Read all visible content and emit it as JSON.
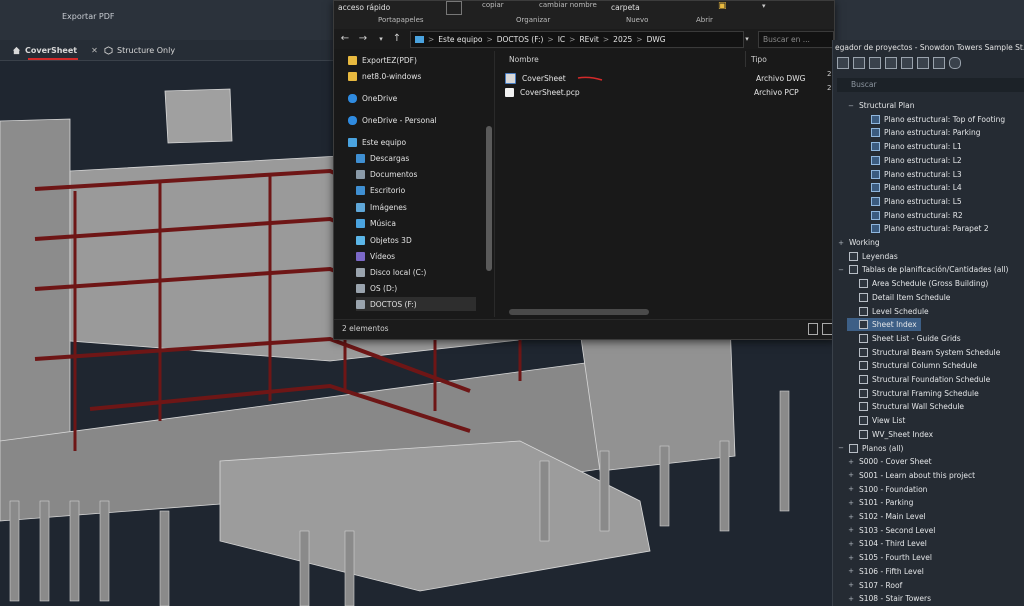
{
  "revit": {
    "ribbon_label": "Exportar PDF",
    "view_tabs": [
      "CoverSheet",
      "Structure Only"
    ],
    "close_glyph": "✕"
  },
  "explorer": {
    "ribbon": {
      "quick_access": "acceso rápido",
      "groups": [
        "Portapapeles",
        "Organizar",
        "Nuevo",
        "Abrir"
      ],
      "new_folder_label": "carpeta",
      "clip_1": "copiar",
      "clip_2": "cambiar nombre"
    },
    "breadcrumb": [
      "Este equipo",
      "DOCTOS (F:)",
      "IC",
      "REvit",
      "2025",
      "DWG"
    ],
    "breadcrumb_sep": ">",
    "search_placeholder": "Buscar en ...",
    "nav_items": [
      {
        "label": "ExportEZ(PDF)",
        "icon": "folder-icon",
        "color": "#e8b93f"
      },
      {
        "label": "net8.0-windows",
        "icon": "folder-icon",
        "color": "#e8b93f"
      },
      {
        "label": "OneDrive",
        "icon": "cloud-icon",
        "color": "#2f8be0"
      },
      {
        "label": "OneDrive - Personal",
        "icon": "cloud-icon",
        "color": "#2f8be0"
      },
      {
        "label": "Este equipo",
        "icon": "computer-icon",
        "color": "#4aa3df"
      },
      {
        "label": "Descargas",
        "icon": "downloads-icon",
        "color": "#3f8fd2"
      },
      {
        "label": "Documentos",
        "icon": "documents-icon",
        "color": "#8a9aa8"
      },
      {
        "label": "Escritorio",
        "icon": "desktop-icon",
        "color": "#3f8fd2"
      },
      {
        "label": "Imágenes",
        "icon": "pictures-icon",
        "color": "#5fa7d8"
      },
      {
        "label": "Música",
        "icon": "music-icon",
        "color": "#4aa3df"
      },
      {
        "label": "Objetos 3D",
        "icon": "objects3d-icon",
        "color": "#5bb6e8"
      },
      {
        "label": "Vídeos",
        "icon": "videos-icon",
        "color": "#7c69c8"
      },
      {
        "label": "Disco local (C:)",
        "icon": "drive-icon",
        "color": "#9aa4ae"
      },
      {
        "label": "OS (D:)",
        "icon": "drive-icon",
        "color": "#9aa4ae"
      },
      {
        "label": "DOCTOS (F:)",
        "icon": "drive-icon",
        "color": "#9aa4ae"
      }
    ],
    "columns": [
      "Nombre",
      "Tipo"
    ],
    "files": [
      {
        "name": "CoverSheet",
        "type": "Archivo DWG",
        "icon": "dwg-file-icon"
      },
      {
        "name": "CoverSheet.pcp",
        "type": "Archivo PCP",
        "icon": "text-file-icon"
      }
    ],
    "status": "2 elementos"
  },
  "project_browser": {
    "title": "egador de proyectos - Snowdon Towers Sample St...",
    "search_placeholder": "Buscar",
    "tree": [
      {
        "label": "Structural Plan",
        "level": 1,
        "exp": "−",
        "icon": "none"
      },
      {
        "label": "Plano estructural: Top of Footing",
        "level": 2,
        "icon": "view"
      },
      {
        "label": "Plano estructural: Parking",
        "level": 2,
        "icon": "view"
      },
      {
        "label": "Plano estructural: L1",
        "level": 2,
        "icon": "view"
      },
      {
        "label": "Plano estructural: L2",
        "level": 2,
        "icon": "view"
      },
      {
        "label": "Plano estructural: L3",
        "level": 2,
        "icon": "view"
      },
      {
        "label": "Plano estructural: L4",
        "level": 2,
        "icon": "view"
      },
      {
        "label": "Plano estructural: L5",
        "level": 2,
        "icon": "view"
      },
      {
        "label": "Plano estructural: R2",
        "level": 2,
        "icon": "view"
      },
      {
        "label": "Plano estructural: Parapet 2",
        "level": 2,
        "icon": "view"
      },
      {
        "label": "Working",
        "level": 0,
        "exp": "+",
        "icon": "none"
      },
      {
        "label": "Leyendas",
        "level": 0,
        "exp": "",
        "icon": "schedule"
      },
      {
        "label": "Tablas de planificación/Cantidades (all)",
        "level": 0,
        "exp": "−",
        "icon": "schedule"
      },
      {
        "label": "Area Schedule (Gross Building)",
        "level": 1,
        "icon": "schedule"
      },
      {
        "label": "Detail Item Schedule",
        "level": 1,
        "icon": "schedule"
      },
      {
        "label": "Level Schedule",
        "level": 1,
        "icon": "schedule"
      },
      {
        "label": "Sheet Index",
        "level": 1,
        "icon": "schedule",
        "selected": true
      },
      {
        "label": "Sheet List - Guide Grids",
        "level": 1,
        "icon": "schedule"
      },
      {
        "label": "Structural Beam System Schedule",
        "level": 1,
        "icon": "schedule"
      },
      {
        "label": "Structural Column Schedule",
        "level": 1,
        "icon": "schedule"
      },
      {
        "label": "Structural Foundation Schedule",
        "level": 1,
        "icon": "schedule"
      },
      {
        "label": "Structural Framing Schedule",
        "level": 1,
        "icon": "schedule"
      },
      {
        "label": "Structural Wall Schedule",
        "level": 1,
        "icon": "schedule"
      },
      {
        "label": "View List",
        "level": 1,
        "icon": "schedule"
      },
      {
        "label": "WV_Sheet Index",
        "level": 1,
        "icon": "schedule"
      },
      {
        "label": "Planos (all)",
        "level": 0,
        "exp": "−",
        "icon": "sheet"
      },
      {
        "label": "S000 - Cover Sheet",
        "level": 1,
        "exp": "+",
        "icon": "none"
      },
      {
        "label": "S001 - Learn about this project",
        "level": 1,
        "exp": "+",
        "icon": "none"
      },
      {
        "label": "S100 - Foundation",
        "level": 1,
        "exp": "+",
        "icon": "none"
      },
      {
        "label": "S101 - Parking",
        "level": 1,
        "exp": "+",
        "icon": "none"
      },
      {
        "label": "S102 - Main Level",
        "level": 1,
        "exp": "+",
        "icon": "none"
      },
      {
        "label": "S103 - Second Level",
        "level": 1,
        "exp": "+",
        "icon": "none"
      },
      {
        "label": "S104 - Third Level",
        "level": 1,
        "exp": "+",
        "icon": "none"
      },
      {
        "label": "S105 - Fourth Level",
        "level": 1,
        "exp": "+",
        "icon": "none"
      },
      {
        "label": "S106 - Fifth Level",
        "level": 1,
        "exp": "+",
        "icon": "none"
      },
      {
        "label": "S107 - Roof",
        "level": 1,
        "exp": "+",
        "icon": "none"
      },
      {
        "label": "S108 - Stair Towers",
        "level": 1,
        "exp": "+",
        "icon": "none"
      }
    ],
    "side_numbers": [
      "2",
      "2"
    ]
  },
  "colors": {
    "accent_red": "#d42a2a",
    "beam_red": "#7a1a1a",
    "concrete": "#8f8f8f"
  }
}
